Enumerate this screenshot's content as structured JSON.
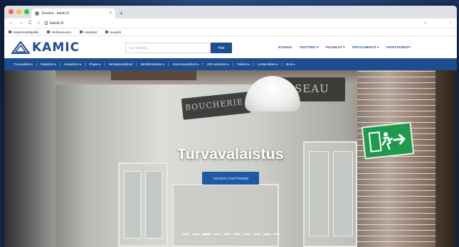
{
  "browser": {
    "tab_title": "Etusivu - kamic.fi",
    "tab_close": "×",
    "new_tab": "+",
    "url": "kamic.fi",
    "nav_back": "←",
    "nav_forward": "→",
    "nav_reload": "C",
    "nav_home": "⌂",
    "bookmarks": [
      "Kirjanmerkkipalkki",
      "Verkkosivusto",
      "Asiakirjat",
      "Suosikit"
    ]
  },
  "site": {
    "logo_text": "KAMIC",
    "search_placeholder": "Hae tuotteita...",
    "search_button": "Hae",
    "top_nav": [
      "ETUSIVU",
      "TUOTTEET ▾",
      "PALVELUT ▾",
      "TIETOA MEISTÄ ▾",
      "YHTEYSTIEDOT"
    ],
    "categories": [
      "Turvavalaistus",
      "Valaisimet ▾",
      "Kaapelointi ▾",
      "Ohjaus ▾",
      "Kiinnitystarvikkeet",
      "Sähkökeskukset ▾",
      "Asennustarvikkeet ▾",
      "LED-valaisimet ▾",
      "Palvelut ▾",
      "Lisätarvikkeet ▾",
      "Muut ▾"
    ]
  },
  "hero": {
    "title": "Turvavalaistus",
    "button_label": "TUTUSTU TUOTTEISIIN",
    "sign_left": "BOUCHERIE",
    "sign_right": "SSEAU",
    "slide_count": 10,
    "active_slide": 2
  },
  "colors": {
    "brand": "#1d4e8f",
    "exit_green": "#1f9a4c"
  }
}
